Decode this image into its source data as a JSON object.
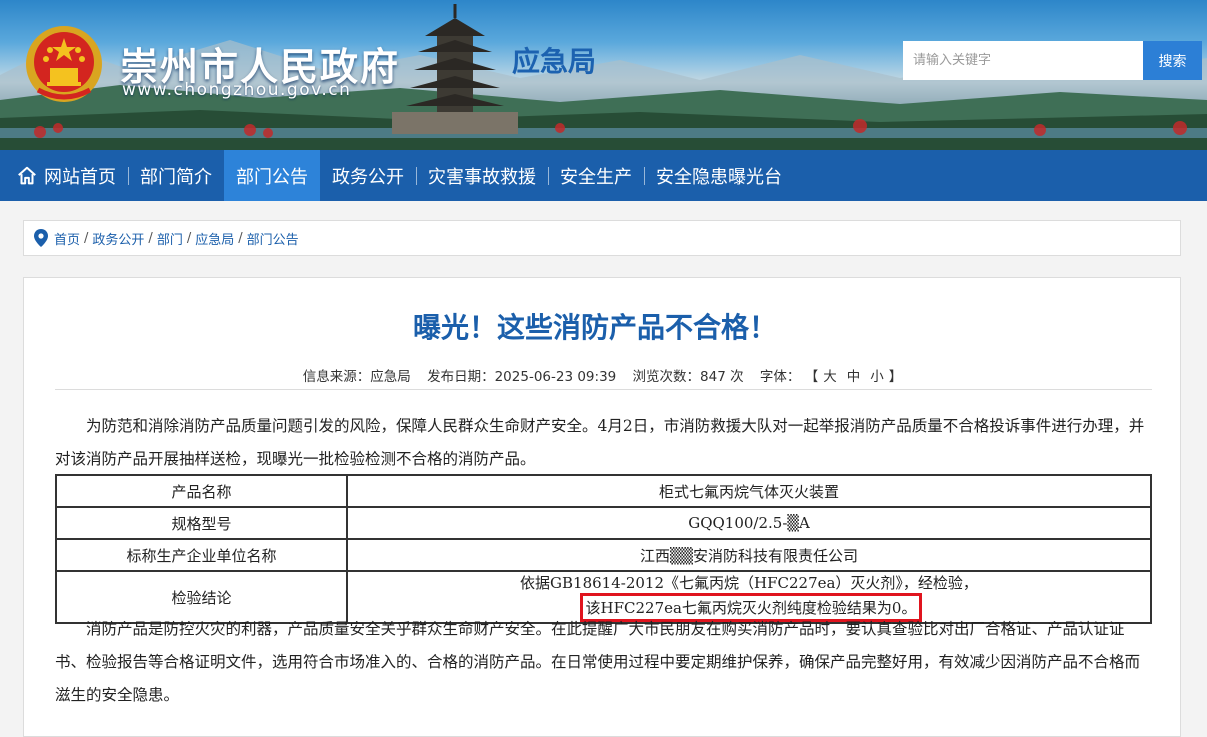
{
  "header": {
    "site_name": "崇州市人民政府",
    "site_url": "www.chongzhou.gov.cn",
    "department": "应急局",
    "search": {
      "placeholder": "请输入关键字",
      "button_label": "搜索"
    }
  },
  "nav": {
    "items": [
      {
        "label": "网站首页",
        "icon": "home-icon"
      },
      {
        "label": "部门简介"
      },
      {
        "label": "部门公告",
        "active": true
      },
      {
        "label": "政务公开"
      },
      {
        "label": "灾害事故救援"
      },
      {
        "label": "安全生产"
      },
      {
        "label": "安全隐患曝光台"
      }
    ]
  },
  "breadcrumb": {
    "icon": "location-pin-icon",
    "items": [
      "首页",
      "政务公开",
      "部门",
      "应急局",
      "部门公告"
    ],
    "separator": "/"
  },
  "article": {
    "title": "曝光！这些消防产品不合格！",
    "meta": {
      "source_label": "信息来源：",
      "source": "应急局",
      "date_label": "发布日期：",
      "date": "2025-06-23 09:39",
      "views_label": "浏览次数：",
      "views": "847 次",
      "font_label": "字体：",
      "bracket_open": "【",
      "bracket_close": "】",
      "font_large": "大",
      "font_medium": "中",
      "font_small": "小"
    },
    "intro": "为防范和消除消防产品质量问题引发的风险，保障人民群众生命财产安全。4月2日，市消防救援大队对一起举报消防产品质量不合格投诉事件进行办理，并对该消防产品开展抽样送检，现曝光一批检验检测不合格的消防产品。",
    "table": [
      {
        "key": "产品名称",
        "value": "柜式七氟丙烷气体灭火装置"
      },
      {
        "key": "规格型号",
        "value": "GQQ100/2.5-▒A"
      },
      {
        "key": "标称生产企业单位名称",
        "value": "江西▒▒安消防科技有限责任公司"
      },
      {
        "key": "检验结论",
        "value": "依据GB18614-2012《七氟丙烷（HFC227ea）灭火剂》，经检验，",
        "highlight": "该HFC227ea七氟丙烷灭火剂纯度检验结果为0。"
      }
    ],
    "closing": "消防产品是防控火灾的利器，产品质量安全关乎群众生命财产安全。在此提醒广大市民朋友在购买消防产品时，要认真查验比对出厂合格证、产品认证证书、检验报告等合格证明文件，选用符合市场准入的、合格的消防产品。在日常使用过程中要定期维护保养，确保产品完整好用，有效减少因消防产品不合格而滋生的安全隐患。"
  },
  "colors": {
    "nav_bg": "#1b5fab",
    "nav_active": "#2d83d9",
    "title": "#1b5fab",
    "highlight_border": "#e0141e"
  }
}
